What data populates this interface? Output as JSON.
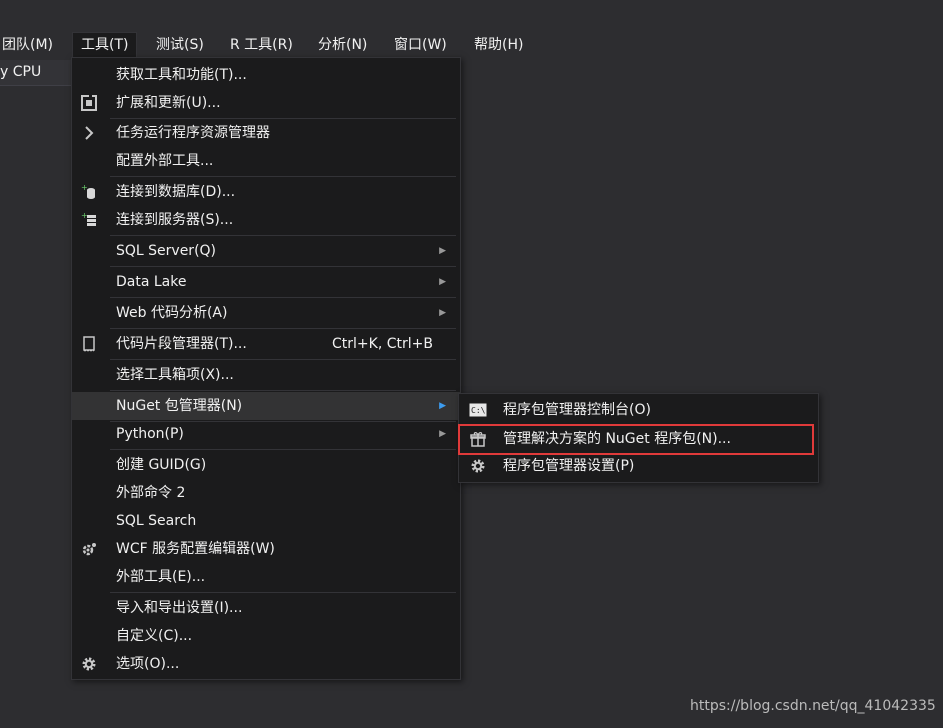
{
  "menubar": {
    "items": [
      {
        "label": "团队(M)"
      },
      {
        "label": "工具(T)"
      },
      {
        "label": "测试(S)"
      },
      {
        "label": "R 工具(R)"
      },
      {
        "label": "分析(N)"
      },
      {
        "label": "窗口(W)"
      },
      {
        "label": "帮助(H)"
      }
    ]
  },
  "toolbar": {
    "platform_combo": "y CPU"
  },
  "tools_menu": {
    "items": [
      {
        "label": "获取工具和功能(T)..."
      },
      {
        "label": "扩展和更新(U)..."
      },
      {
        "label": "任务运行程序资源管理器"
      },
      {
        "label": "配置外部工具..."
      },
      {
        "label": "连接到数据库(D)..."
      },
      {
        "label": "连接到服务器(S)..."
      },
      {
        "label": "SQL Server(Q)"
      },
      {
        "label": "Data Lake"
      },
      {
        "label": "Web 代码分析(A)"
      },
      {
        "label": "代码片段管理器(T)...",
        "shortcut": "Ctrl+K, Ctrl+B"
      },
      {
        "label": "选择工具箱项(X)..."
      },
      {
        "label": "NuGet 包管理器(N)"
      },
      {
        "label": "Python(P)"
      },
      {
        "label": "创建 GUID(G)"
      },
      {
        "label": "外部命令 2"
      },
      {
        "label": "SQL Search"
      },
      {
        "label": "WCF 服务配置编辑器(W)"
      },
      {
        "label": "外部工具(E)..."
      },
      {
        "label": "导入和导出设置(I)..."
      },
      {
        "label": "自定义(C)..."
      },
      {
        "label": "选项(O)..."
      }
    ]
  },
  "nuget_submenu": {
    "items": [
      {
        "label": "程序包管理器控制台(O)"
      },
      {
        "label": "管理解决方案的 NuGet 程序包(N)..."
      },
      {
        "label": "程序包管理器设置(P)"
      }
    ]
  },
  "watermark": "https://blog.csdn.net/qq_41042335",
  "colors": {
    "background": "#2d2d30",
    "menu_bg": "#1b1b1c",
    "highlight": "#333334",
    "annotation_red": "#e03a3a"
  }
}
